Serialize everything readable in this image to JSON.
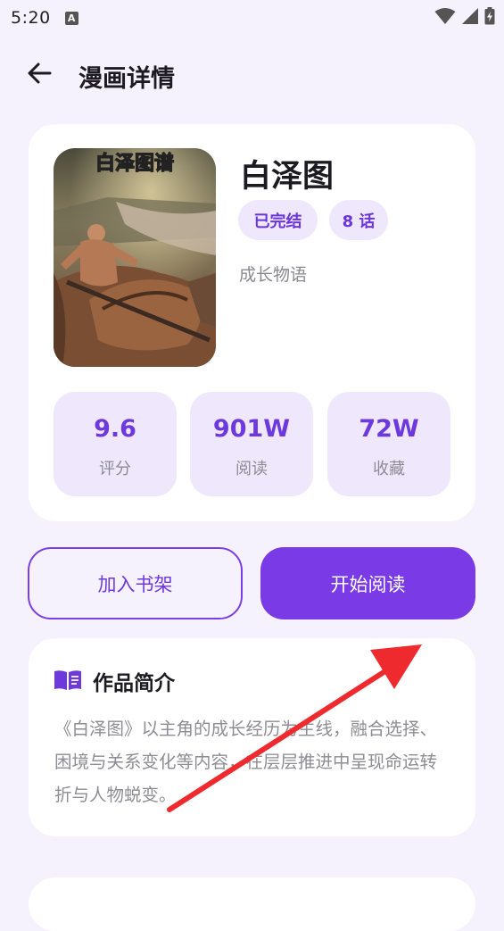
{
  "status_bar": {
    "time": "5:20",
    "notification_icon": "A"
  },
  "header": {
    "title": "漫画详情"
  },
  "comic": {
    "title": "白泽图",
    "cover_text": "白泽图谱",
    "status_badge": "已完结",
    "episodes_badge": "8 话",
    "genre": "成长物语"
  },
  "stats": [
    {
      "value": "9.6",
      "label": "评分"
    },
    {
      "value": "901W",
      "label": "阅读"
    },
    {
      "value": "72W",
      "label": "收藏"
    }
  ],
  "actions": {
    "add_to_shelf": "加入书架",
    "start_reading": "开始阅读"
  },
  "intro": {
    "heading": "作品简介",
    "text": "《白泽图》以主角的成长经历为主线，融合选择、困境与关系变化等内容，在层层推进中呈现命运转折与人物蜕变。"
  },
  "colors": {
    "accent": "#7a3ae6",
    "accent_light": "#efe7fc",
    "background": "#f6f2fd",
    "annotation_arrow": "#ee2a2f"
  }
}
